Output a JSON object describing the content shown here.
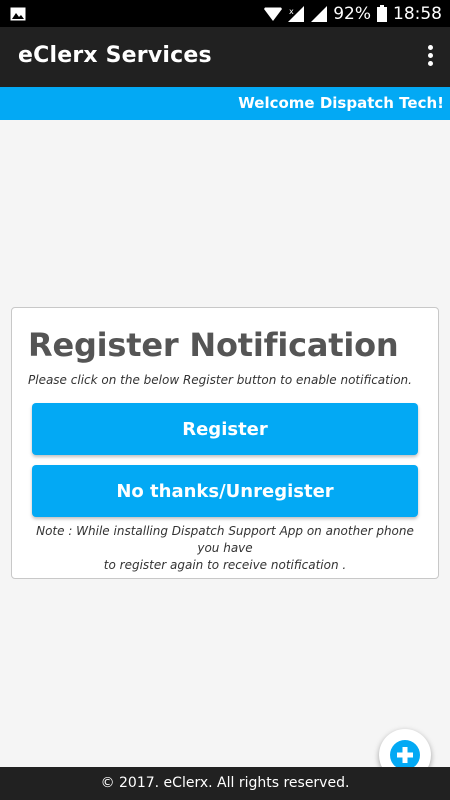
{
  "status_bar": {
    "battery": "92%",
    "time": "18:58"
  },
  "app_bar": {
    "title": "eClerx Services",
    "menu_icon": "more-vert-icon"
  },
  "welcome_banner": {
    "text": "Welcome Dispatch Tech!",
    "color": "#03a9f4"
  },
  "card": {
    "title": "Register Notification",
    "subtitle": "Please click on the below Register button to enable notification.",
    "register_label": "Register",
    "unregister_label": "No thanks/Unregister",
    "note_line1": "Note : While installing Dispatch Support App on another phone you have",
    "note_line2": "to register again to receive notification ."
  },
  "fab": {
    "icon": "add-circle-icon",
    "color": "#03a9f4"
  },
  "footer": {
    "text": "© 2017. eClerx. All rights reserved."
  }
}
